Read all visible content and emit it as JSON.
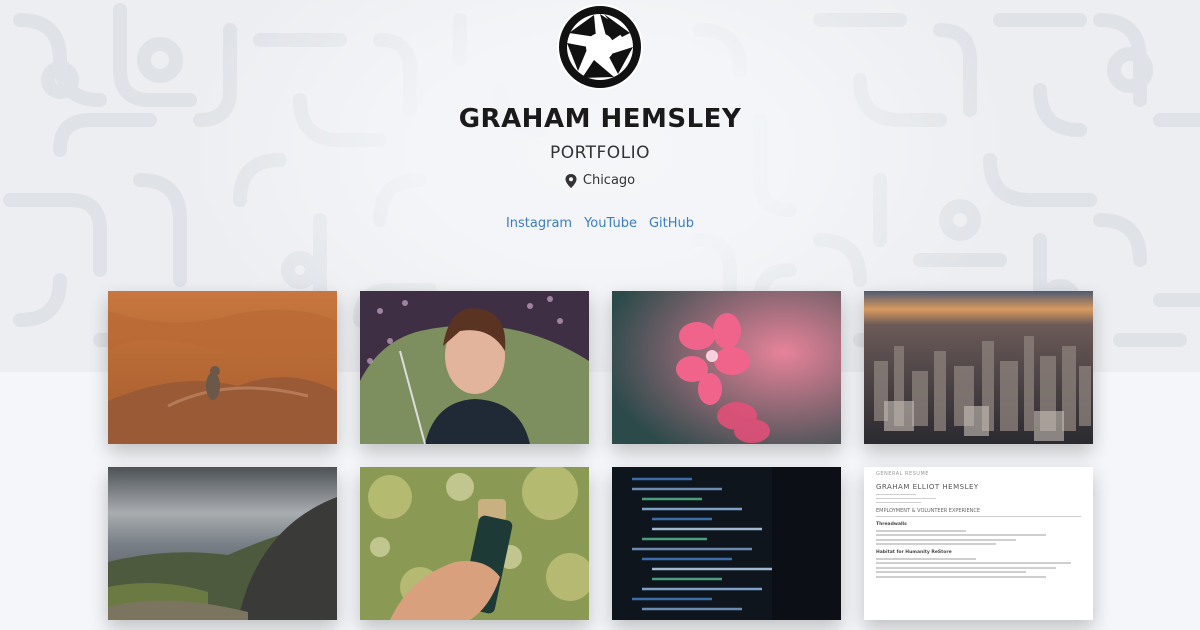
{
  "header": {
    "name": "GRAHAM HEMSLEY",
    "subtitle": "PORTFOLIO",
    "location": "Chicago",
    "location_icon": "map-pin-icon",
    "logo_icon": "camera-aperture-icon"
  },
  "links": [
    {
      "label": "Instagram"
    },
    {
      "label": "YouTube"
    },
    {
      "label": "GitHub"
    }
  ],
  "gallery": [
    {
      "subject": "meerkat"
    },
    {
      "subject": "woman with umbrella"
    },
    {
      "subject": "pink flower"
    },
    {
      "subject": "city skyline"
    },
    {
      "subject": "coastline"
    },
    {
      "subject": "microphone"
    },
    {
      "subject": "code screen"
    },
    {
      "subject": "resume"
    }
  ],
  "resume": {
    "heading": "GENERAL RESUME",
    "name": "GRAHAM ELLIOT HEMSLEY",
    "section": "EMPLOYMENT & VOLUNTEER EXPERIENCE",
    "org1": "Threadwalls",
    "org2": "Habitat for Humanity ReStore"
  },
  "colors": {
    "link": "#3b7dc4",
    "background": "#f4f6f9"
  }
}
